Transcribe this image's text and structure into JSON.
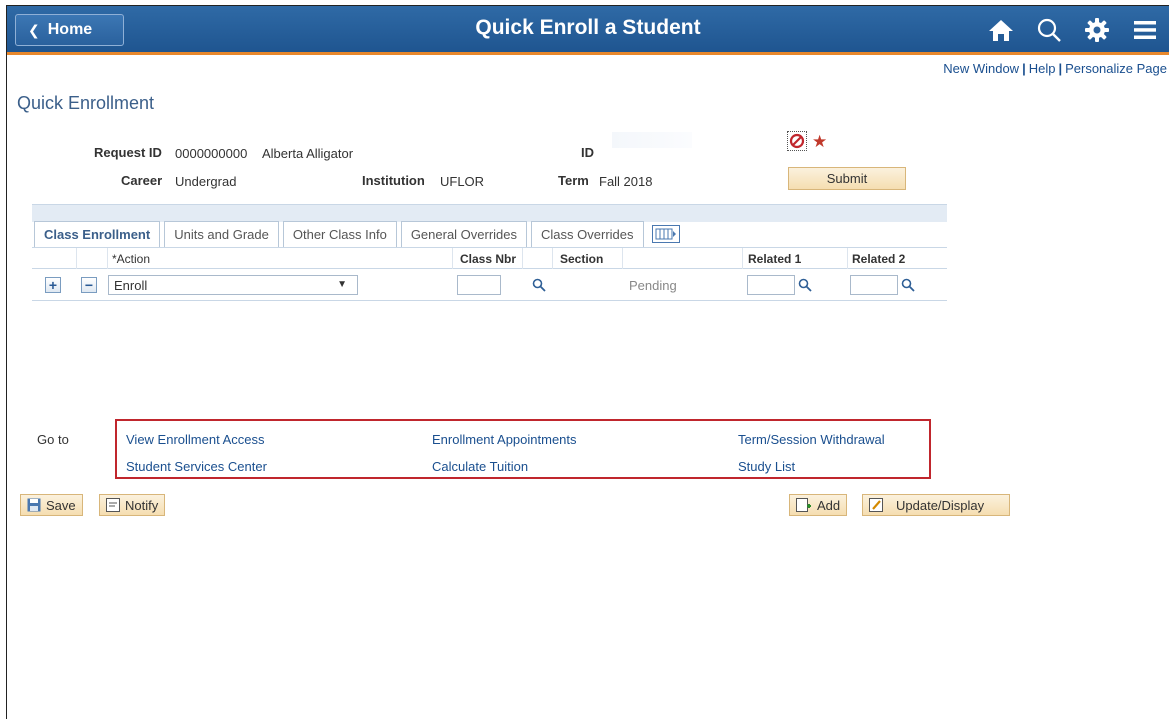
{
  "banner": {
    "home_label": "Home",
    "title": "Quick Enroll a Student",
    "icons": [
      "home-icon",
      "search-icon",
      "gear-icon",
      "menu-icon"
    ]
  },
  "top_links": {
    "new_window": "New Window",
    "help": "Help",
    "personalize": "Personalize Page",
    "separator": "|"
  },
  "page_title": "Quick Enrollment",
  "header": {
    "request_id_label": "Request ID",
    "request_id_value": "0000000000",
    "student_name": "Alberta Alligator",
    "id_label": "ID",
    "career_label": "Career",
    "career_value": "Undergrad",
    "institution_label": "Institution",
    "institution_value": "UFLOR",
    "term_label": "Term",
    "term_value": "Fall 2018",
    "submit_label": "Submit",
    "warn_icon": "prohibited-icon",
    "required_icon": "star-icon"
  },
  "tabs": [
    {
      "label": "Class Enrollment",
      "active": true
    },
    {
      "label": "Units and Grade",
      "active": false
    },
    {
      "label": "Other Class Info",
      "active": false
    },
    {
      "label": "General Overrides",
      "active": false
    },
    {
      "label": "Class Overrides",
      "active": false
    }
  ],
  "columns": {
    "action": "*Action",
    "class_nbr": "Class Nbr",
    "section": "Section",
    "related1": "Related 1",
    "related2": "Related 2"
  },
  "row": {
    "action_value": "Enroll",
    "class_nbr_value": "",
    "status": "Pending",
    "related1_value": "",
    "related2_value": ""
  },
  "goto": {
    "label": "Go to",
    "links": [
      "View Enrollment Access",
      "Enrollment Appointments",
      "Term/Session Withdrawal",
      "Student Services Center",
      "Calculate Tuition",
      "Study List"
    ]
  },
  "buttons": {
    "save": "Save",
    "notify": "Notify",
    "add": "Add",
    "update_display": "Update/Display"
  },
  "colors": {
    "banner": "#2a619d",
    "banner_accent": "#e8882c",
    "link": "#1a4f8f",
    "highlight_box": "#c0262d"
  }
}
